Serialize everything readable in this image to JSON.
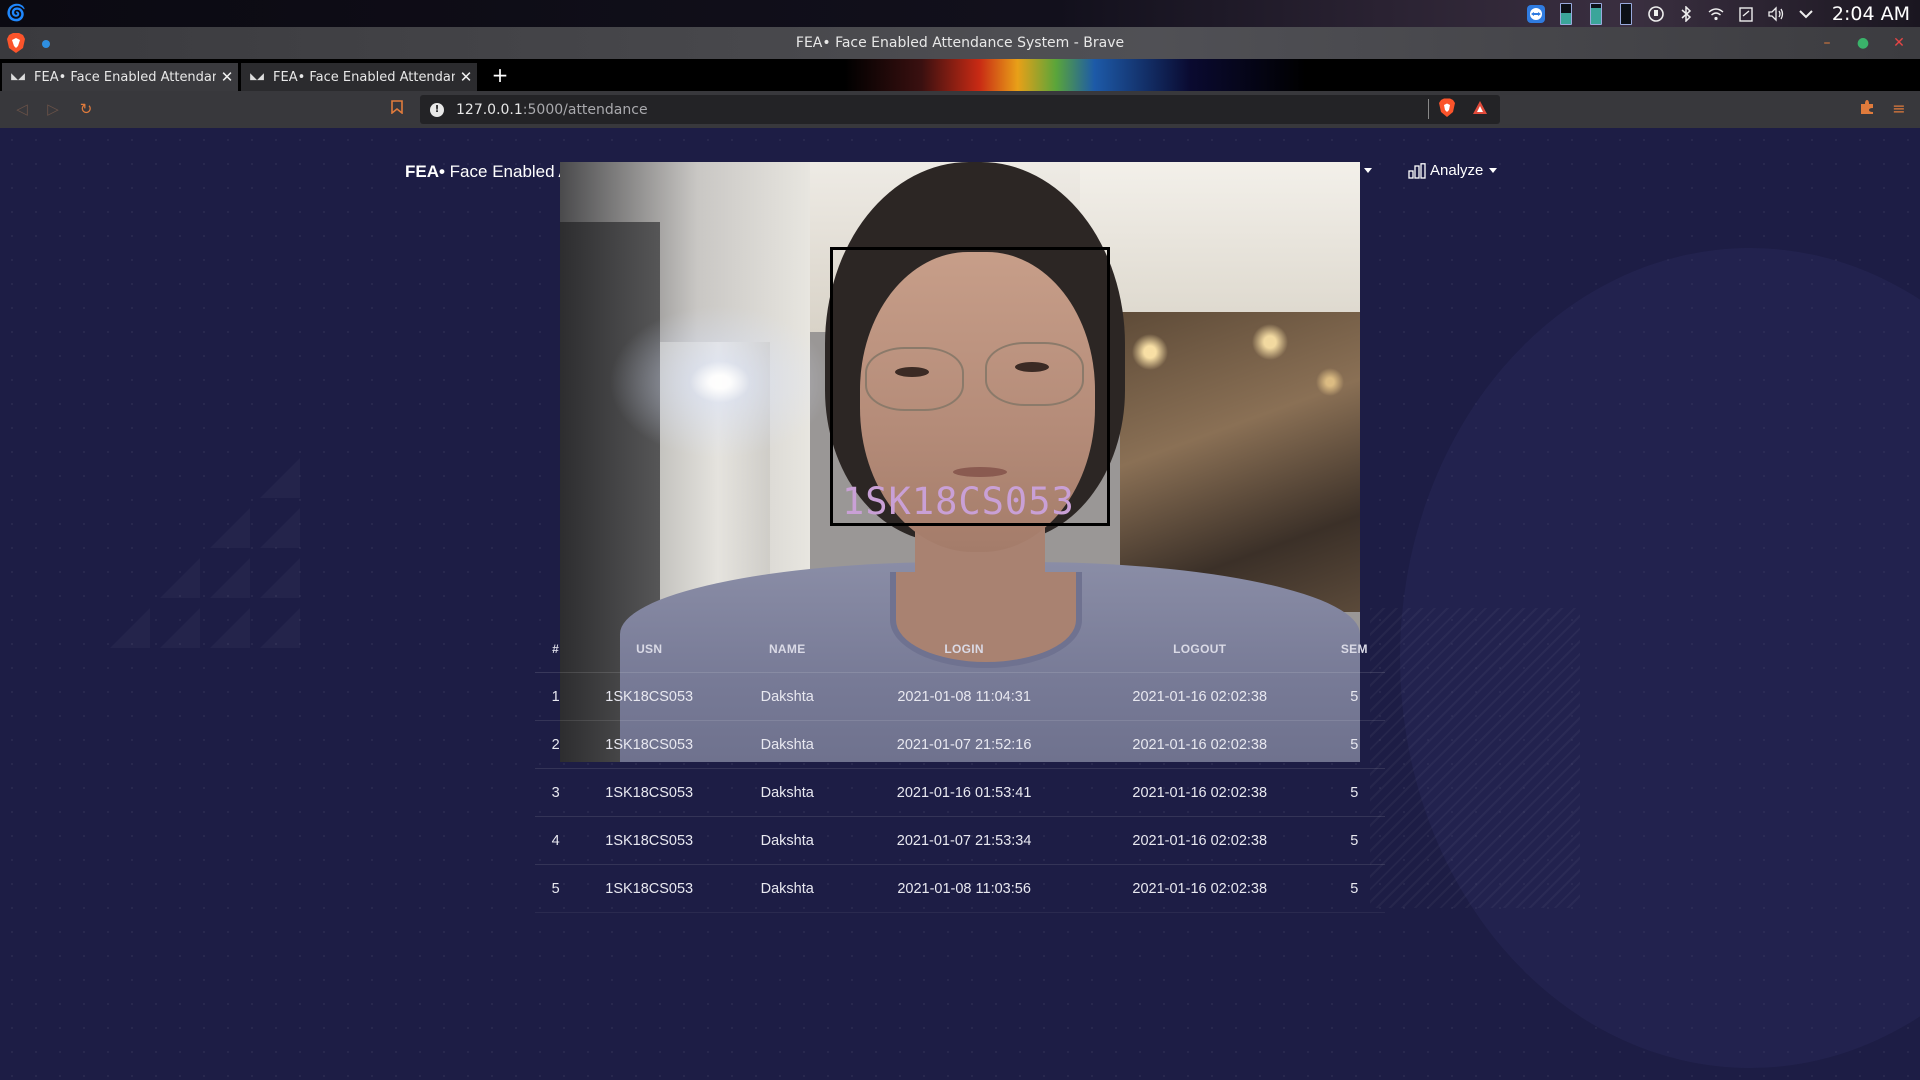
{
  "os_panel": {
    "clock": "2:04 AM",
    "tray_icons": [
      "teamviewer-icon",
      "battery-icon",
      "battery-icon",
      "battery-icon",
      "keyboard-icon",
      "bluetooth-icon",
      "wifi-icon",
      "clipboard-icon",
      "volume-icon",
      "chevron-down-icon"
    ]
  },
  "browser": {
    "window_title": "FEA• Face Enabled Attendance System - Brave",
    "tabs": [
      {
        "label": "FEA• Face Enabled Attendance",
        "active": true
      },
      {
        "label": "FEA• Face Enabled Attendance",
        "active": false
      }
    ],
    "url_host": "127.0.0.1",
    "url_path": ":5000/attendance"
  },
  "app": {
    "brand_bold": "FEA•",
    "brand_rest": " Face Enabled A",
    "analyze_label": "Analyze",
    "face_label": "1SK18CS053"
  },
  "table": {
    "headers": [
      "#",
      "USN",
      "NAME",
      "LOGIN",
      "LOGOUT",
      "SEM"
    ],
    "rows": [
      [
        "1",
        "1SK18CS053",
        "Dakshta",
        "2021-01-08 11:04:31",
        "2021-01-16 02:02:38",
        "5"
      ],
      [
        "2",
        "1SK18CS053",
        "Dakshta",
        "2021-01-07 21:52:16",
        "2021-01-16 02:02:38",
        "5"
      ],
      [
        "3",
        "1SK18CS053",
        "Dakshta",
        "2021-01-16 01:53:41",
        "2021-01-16 02:02:38",
        "5"
      ],
      [
        "4",
        "1SK18CS053",
        "Dakshta",
        "2021-01-07 21:53:34",
        "2021-01-16 02:02:38",
        "5"
      ],
      [
        "5",
        "1SK18CS053",
        "Dakshta",
        "2021-01-08 11:03:56",
        "2021-01-16 02:02:38",
        "5"
      ]
    ]
  },
  "colors": {
    "page_bg": "#1d1d45",
    "browser_accent": "#e07b3c",
    "face_label": "#c9a0d6"
  }
}
